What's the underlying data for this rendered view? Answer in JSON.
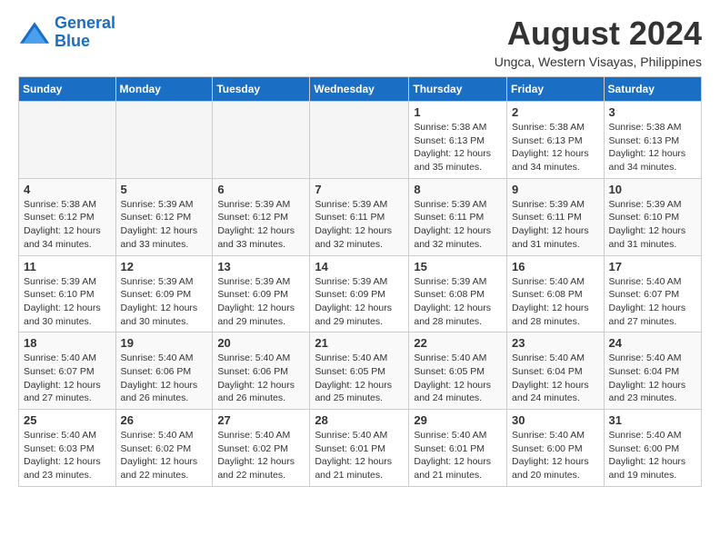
{
  "logo": {
    "line1": "General",
    "line2": "Blue"
  },
  "title": "August 2024",
  "location": "Ungca, Western Visayas, Philippines",
  "days_of_week": [
    "Sunday",
    "Monday",
    "Tuesday",
    "Wednesday",
    "Thursday",
    "Friday",
    "Saturday"
  ],
  "weeks": [
    [
      {
        "day": "",
        "empty": true
      },
      {
        "day": "",
        "empty": true
      },
      {
        "day": "",
        "empty": true
      },
      {
        "day": "",
        "empty": true
      },
      {
        "day": "1",
        "sunrise": "5:38 AM",
        "sunset": "6:13 PM",
        "daylight": "12 hours and 35 minutes."
      },
      {
        "day": "2",
        "sunrise": "5:38 AM",
        "sunset": "6:13 PM",
        "daylight": "12 hours and 34 minutes."
      },
      {
        "day": "3",
        "sunrise": "5:38 AM",
        "sunset": "6:13 PM",
        "daylight": "12 hours and 34 minutes."
      }
    ],
    [
      {
        "day": "4",
        "sunrise": "5:38 AM",
        "sunset": "6:12 PM",
        "daylight": "12 hours and 34 minutes."
      },
      {
        "day": "5",
        "sunrise": "5:39 AM",
        "sunset": "6:12 PM",
        "daylight": "12 hours and 33 minutes."
      },
      {
        "day": "6",
        "sunrise": "5:39 AM",
        "sunset": "6:12 PM",
        "daylight": "12 hours and 33 minutes."
      },
      {
        "day": "7",
        "sunrise": "5:39 AM",
        "sunset": "6:11 PM",
        "daylight": "12 hours and 32 minutes."
      },
      {
        "day": "8",
        "sunrise": "5:39 AM",
        "sunset": "6:11 PM",
        "daylight": "12 hours and 32 minutes."
      },
      {
        "day": "9",
        "sunrise": "5:39 AM",
        "sunset": "6:11 PM",
        "daylight": "12 hours and 31 minutes."
      },
      {
        "day": "10",
        "sunrise": "5:39 AM",
        "sunset": "6:10 PM",
        "daylight": "12 hours and 31 minutes."
      }
    ],
    [
      {
        "day": "11",
        "sunrise": "5:39 AM",
        "sunset": "6:10 PM",
        "daylight": "12 hours and 30 minutes."
      },
      {
        "day": "12",
        "sunrise": "5:39 AM",
        "sunset": "6:09 PM",
        "daylight": "12 hours and 30 minutes."
      },
      {
        "day": "13",
        "sunrise": "5:39 AM",
        "sunset": "6:09 PM",
        "daylight": "12 hours and 29 minutes."
      },
      {
        "day": "14",
        "sunrise": "5:39 AM",
        "sunset": "6:09 PM",
        "daylight": "12 hours and 29 minutes."
      },
      {
        "day": "15",
        "sunrise": "5:39 AM",
        "sunset": "6:08 PM",
        "daylight": "12 hours and 28 minutes."
      },
      {
        "day": "16",
        "sunrise": "5:40 AM",
        "sunset": "6:08 PM",
        "daylight": "12 hours and 28 minutes."
      },
      {
        "day": "17",
        "sunrise": "5:40 AM",
        "sunset": "6:07 PM",
        "daylight": "12 hours and 27 minutes."
      }
    ],
    [
      {
        "day": "18",
        "sunrise": "5:40 AM",
        "sunset": "6:07 PM",
        "daylight": "12 hours and 27 minutes."
      },
      {
        "day": "19",
        "sunrise": "5:40 AM",
        "sunset": "6:06 PM",
        "daylight": "12 hours and 26 minutes."
      },
      {
        "day": "20",
        "sunrise": "5:40 AM",
        "sunset": "6:06 PM",
        "daylight": "12 hours and 26 minutes."
      },
      {
        "day": "21",
        "sunrise": "5:40 AM",
        "sunset": "6:05 PM",
        "daylight": "12 hours and 25 minutes."
      },
      {
        "day": "22",
        "sunrise": "5:40 AM",
        "sunset": "6:05 PM",
        "daylight": "12 hours and 24 minutes."
      },
      {
        "day": "23",
        "sunrise": "5:40 AM",
        "sunset": "6:04 PM",
        "daylight": "12 hours and 24 minutes."
      },
      {
        "day": "24",
        "sunrise": "5:40 AM",
        "sunset": "6:04 PM",
        "daylight": "12 hours and 23 minutes."
      }
    ],
    [
      {
        "day": "25",
        "sunrise": "5:40 AM",
        "sunset": "6:03 PM",
        "daylight": "12 hours and 23 minutes."
      },
      {
        "day": "26",
        "sunrise": "5:40 AM",
        "sunset": "6:02 PM",
        "daylight": "12 hours and 22 minutes."
      },
      {
        "day": "27",
        "sunrise": "5:40 AM",
        "sunset": "6:02 PM",
        "daylight": "12 hours and 22 minutes."
      },
      {
        "day": "28",
        "sunrise": "5:40 AM",
        "sunset": "6:01 PM",
        "daylight": "12 hours and 21 minutes."
      },
      {
        "day": "29",
        "sunrise": "5:40 AM",
        "sunset": "6:01 PM",
        "daylight": "12 hours and 21 minutes."
      },
      {
        "day": "30",
        "sunrise": "5:40 AM",
        "sunset": "6:00 PM",
        "daylight": "12 hours and 20 minutes."
      },
      {
        "day": "31",
        "sunrise": "5:40 AM",
        "sunset": "6:00 PM",
        "daylight": "12 hours and 19 minutes."
      }
    ]
  ]
}
